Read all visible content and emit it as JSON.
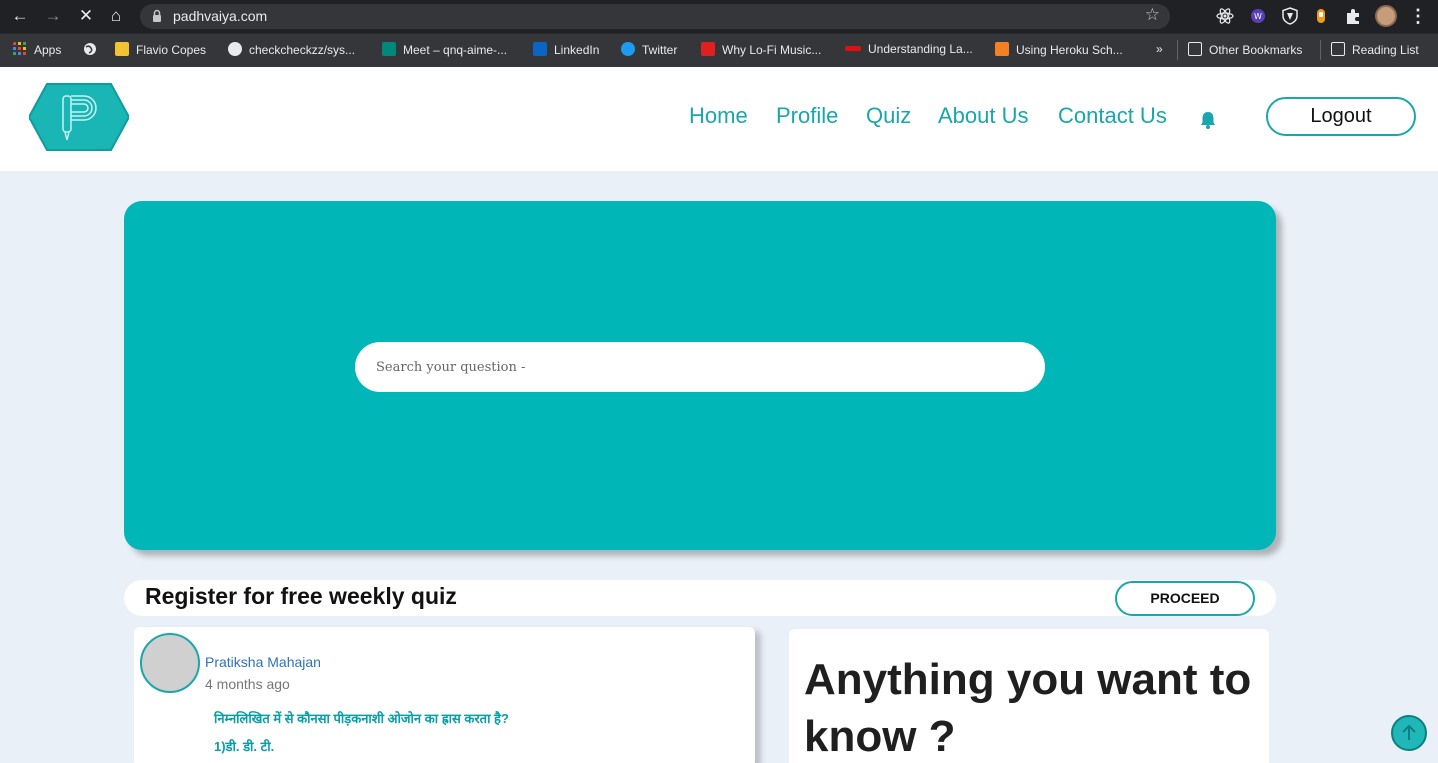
{
  "browser": {
    "url": "padhvaiya.com",
    "bookmarks": {
      "apps": "Apps",
      "items": [
        {
          "label": "Flavio Copes",
          "icon": "flavio-copes-favicon",
          "color": "#f2c230"
        },
        {
          "label": "checkcheckzz/sys...",
          "icon": "github-icon",
          "color": "#e8eaed"
        },
        {
          "label": "Meet – qnq-aime-...",
          "icon": "google-meet-icon",
          "color": "#00897b"
        },
        {
          "label": "LinkedIn",
          "icon": "linkedin-icon",
          "color": "#0a66c2"
        },
        {
          "label": "Twitter",
          "icon": "twitter-icon",
          "color": "#1d9bf0"
        },
        {
          "label": "Why Lo-Fi Music...",
          "icon": "d-favicon",
          "color": "#e02020"
        },
        {
          "label": "Understanding La...",
          "icon": "red-bar-favicon",
          "color": "#e01010"
        },
        {
          "label": "Using Heroku Sch...",
          "icon": "stackoverflow-icon",
          "color": "#f48024"
        }
      ],
      "other": "Other Bookmarks",
      "reading_list": "Reading List"
    }
  },
  "site": {
    "brand_color": "#1aa6ad",
    "hero_color": "#00b6b6",
    "nav": {
      "home": "Home",
      "profile": "Profile",
      "quiz": "Quiz",
      "about": "About Us",
      "contact": "Contact Us",
      "logout": "Logout"
    },
    "search": {
      "placeholder": "Search your question -"
    },
    "register": {
      "text": "Register for free weekly quiz",
      "button": "PROCEED"
    },
    "post": {
      "author": "Pratiksha Mahajan",
      "time": "4 months ago",
      "question": "निम्नलिखित में से कौनसा पीड़कनाशी ओजोन का ह्रास करता है?",
      "option1": "1)डी. डी. टी."
    },
    "side": {
      "heading": "Anything you want to know ?"
    }
  }
}
